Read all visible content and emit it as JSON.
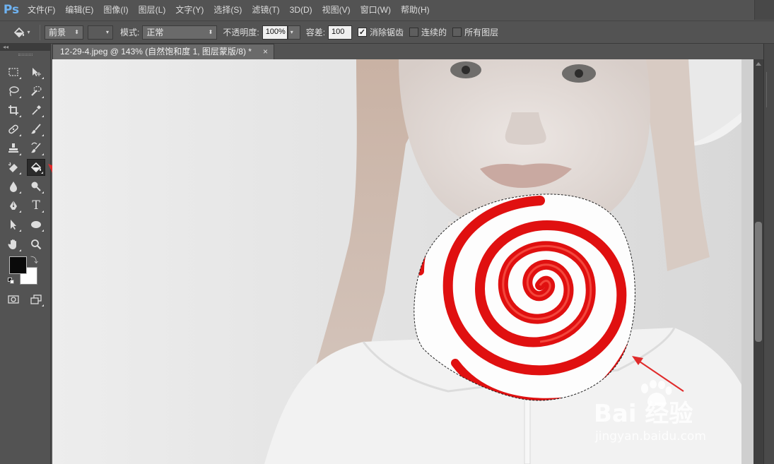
{
  "app": {
    "logo": "Ps"
  },
  "menu": [
    "文件(F)",
    "编辑(E)",
    "图像(I)",
    "图层(L)",
    "文字(Y)",
    "选择(S)",
    "滤镜(T)",
    "3D(D)",
    "视图(V)",
    "窗口(W)",
    "帮助(H)"
  ],
  "options": {
    "fill_source": "前景",
    "mode_label": "模式:",
    "mode_value": "正常",
    "opacity_label": "不透明度:",
    "opacity_value": "100%",
    "tolerance_label": "容差:",
    "tolerance_value": "100",
    "antialias_label": "消除锯齿",
    "antialias_checked": true,
    "contiguous_label": "连续的",
    "contiguous_checked": false,
    "all_layers_label": "所有图层",
    "all_layers_checked": false
  },
  "document": {
    "tab_title": "12-29-4.jpeg @ 143% (自然饱和度 1, 图层蒙版/8) *",
    "close": "×"
  },
  "tools": {
    "active": "paint-bucket-tool",
    "panel_collapse": "◂◂",
    "type_tool_glyph": "T"
  },
  "colors": {
    "foreground": "#0a0a0a",
    "background": "#ffffff",
    "accent_arrow": "#e02a2a",
    "ps_logo": "#6fb3f2",
    "lollipop_red": "#e01010"
  },
  "watermark": {
    "brand": "Bai  经验",
    "url": "jingyan.baidu.com"
  }
}
